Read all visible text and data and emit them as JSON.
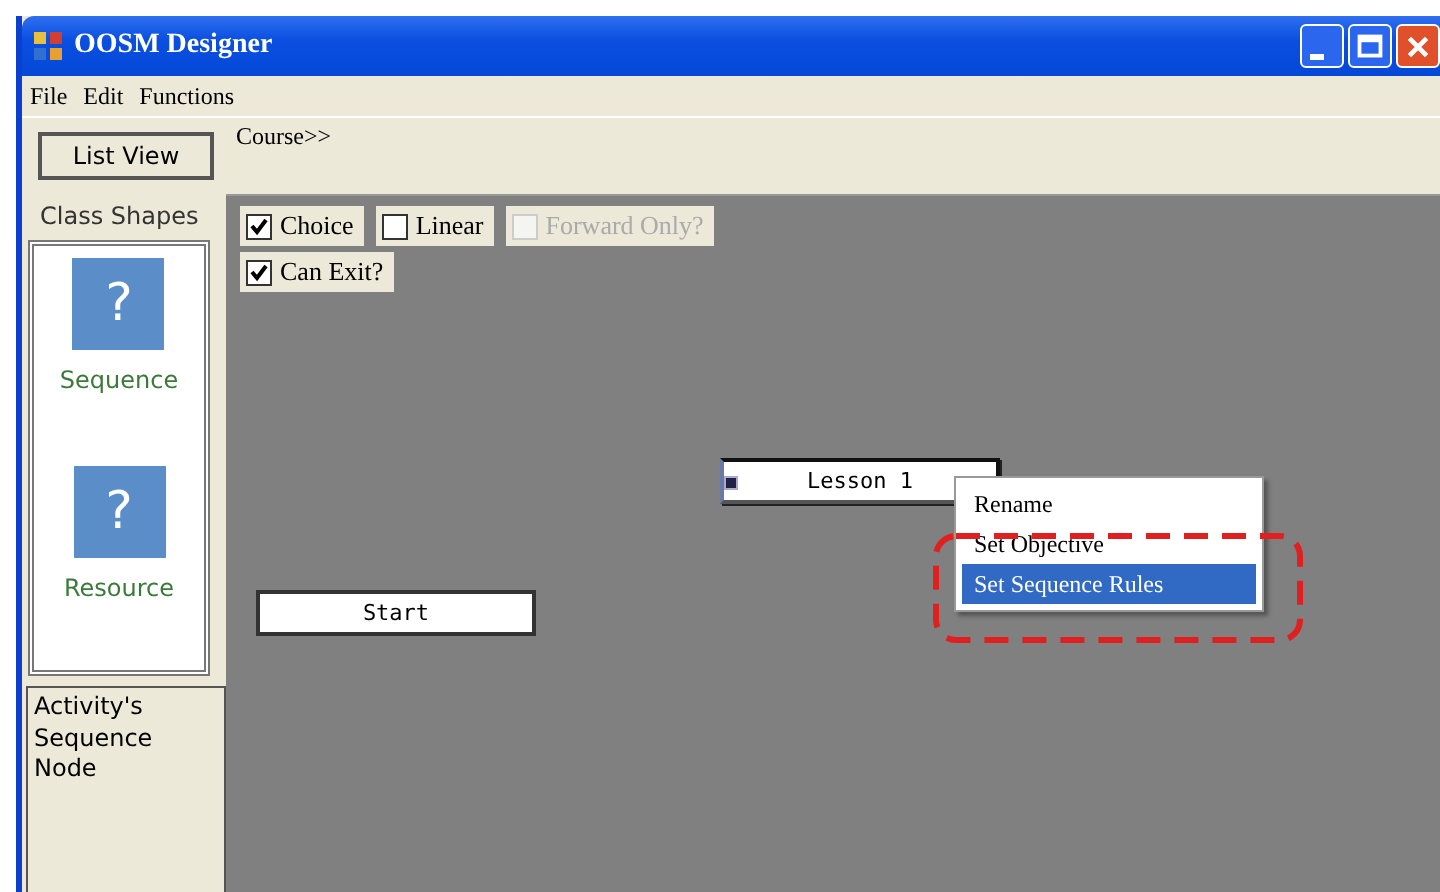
{
  "window": {
    "title": "OOSM Designer"
  },
  "menu": [
    "File",
    "Edit",
    "Functions"
  ],
  "toolbar": {
    "button": "List View",
    "breadcrumb": "Course>>"
  },
  "class_shapes": {
    "title": "Class Shapes",
    "items": [
      {
        "label": "Sequence",
        "glyph": "?"
      },
      {
        "label": "Resource",
        "glyph": "?"
      }
    ]
  },
  "description": "Activity's Sequence Node",
  "option_rows": [
    [
      {
        "label": "Choice",
        "checked": true,
        "disabled": false
      },
      {
        "label": "Linear",
        "checked": false,
        "disabled": false
      },
      {
        "label": "Forward Only?",
        "checked": false,
        "disabled": true
      }
    ],
    [
      {
        "label": "Can Exit?",
        "checked": true,
        "disabled": false
      }
    ]
  ],
  "nodes": [
    {
      "label": "Lesson 1",
      "selected": true
    },
    {
      "label": "Start",
      "selected": false
    }
  ],
  "context_menu": [
    {
      "label": "Rename",
      "selected": false
    },
    {
      "label": "Set Objective",
      "selected": false
    },
    {
      "label": "Set Sequence Rules",
      "selected": true
    }
  ]
}
